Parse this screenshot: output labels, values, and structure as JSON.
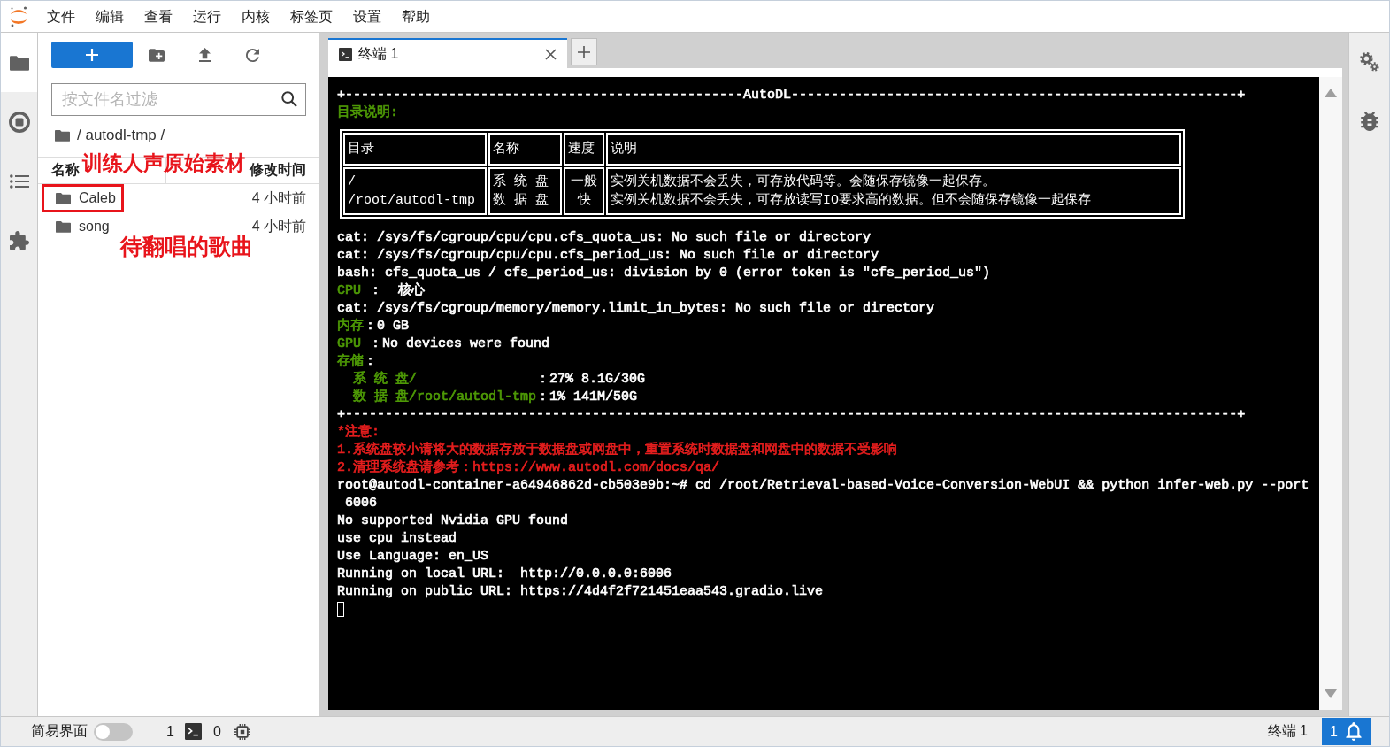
{
  "menu": [
    "文件",
    "编辑",
    "查看",
    "运行",
    "内核",
    "标签页",
    "设置",
    "帮助"
  ],
  "activity_bar": [
    {
      "kind": "files",
      "selected": true
    },
    {
      "kind": "running",
      "selected": false
    },
    {
      "kind": "toc",
      "selected": false
    },
    {
      "kind": "extensions",
      "selected": false
    }
  ],
  "file_browser": {
    "filter": {
      "placeholder": "按文件名过滤"
    },
    "breadcrumb": "/ autodl-tmp /",
    "columns": [
      "名称",
      "修改时间"
    ],
    "items": [
      {
        "name": "Caleb",
        "modified": "4 小时前",
        "boxed": true
      },
      {
        "name": "song",
        "modified": "4 小时前",
        "boxed": false
      }
    ],
    "annotations": [
      "训练人声原始素材",
      "待翻唱的歌曲"
    ]
  },
  "tabs": [
    {
      "label": "终端 1",
      "selected": true
    }
  ],
  "terminal": {
    "header_lines": [
      [
        {
          "text": "+--------------------------------------------------AutoDL--------------------------------------------------------+",
          "color": "#ffffff"
        }
      ],
      [
        {
          "text": "目录说明:",
          "color": "#4e9a06"
        }
      ]
    ],
    "table": {
      "columns": [
        "目录",
        "名称",
        "速度",
        "说明"
      ],
      "rows": [
        [
          [
            "/",
            "/root/autodl-tmp"
          ],
          [
            "系 统 盘",
            "数 据 盘"
          ],
          [
            "一般",
            "快"
          ],
          [
            "实例关机数据不会丢失，可存放代码等。会随保存镜像一起保存。",
            "实例关机数据不会丢失，可存放读写IO要求高的数据。但不会随保存镜像一起保存"
          ]
        ]
      ]
    },
    "lines": [
      [
        {
          "text": "cat: /sys/fs/cgroup/cpu/cpu.cfs_quota_us: No such file or directory",
          "color": "#ffffff"
        }
      ],
      [
        {
          "text": "cat: /sys/fs/cgroup/cpu/cpu.cfs_period_us: No such file or directory",
          "color": "#ffffff"
        }
      ],
      [
        {
          "text": "bash: cfs_quota_us / cfs_period_us: division by 0 (error token is \"cfs_period_us\")",
          "color": "#ffffff"
        }
      ],
      [
        {
          "text": "CPU",
          "color": "#4e9a06"
        },
        {
          "text": " ：  核心",
          "color": "#ffffff"
        }
      ],
      [
        {
          "text": "cat: /sys/fs/cgroup/memory/memory.limit_in_bytes: No such file or directory",
          "color": "#ffffff"
        }
      ],
      [
        {
          "text": "内存",
          "color": "#4e9a06"
        },
        {
          "text": "：0 GB",
          "color": "#ffffff"
        }
      ],
      [
        {
          "text": "GPU",
          "color": "#4e9a06"
        },
        {
          "text": " ：No devices were found",
          "color": "#ffffff"
        }
      ],
      [
        {
          "text": "存储",
          "color": "#4e9a06"
        },
        {
          "text": "：",
          "color": "#ffffff"
        }
      ],
      [
        {
          "text": "  系 统 盘/",
          "color": "#4e9a06"
        },
        {
          "text": "               ：27% 8.1G/30G",
          "color": "#ffffff"
        }
      ],
      [
        {
          "text": "  数 据 盘/root/autodl-tmp",
          "color": "#4e9a06"
        },
        {
          "text": "：1% 141M/50G",
          "color": "#ffffff"
        }
      ],
      [
        {
          "text": "+----------------------------------------------------------------------------------------------------------------+",
          "color": "#ffffff"
        }
      ],
      [
        {
          "text": "*注意:",
          "color": "#e61e1e"
        }
      ],
      [
        {
          "text": "1.系统盘较小请将大的数据存放于数据盘或网盘中，重置系统时数据盘和网盘中的数据不受影响",
          "color": "#e61e1e"
        }
      ],
      [
        {
          "text": "2.清理系统盘请参考：https://www.autodl.com/docs/qa/",
          "color": "#e61e1e"
        }
      ],
      [
        {
          "text": "root@autodl-container-a64946862d-cb503e9b:~# cd /root/Retrieval-based-Voice-Conversion-WebUI && python infer-web.py --port",
          "color": "#ffffff"
        }
      ],
      [
        {
          "text": " 6006",
          "color": "#ffffff"
        }
      ],
      [
        {
          "text": "No supported Nvidia GPU found",
          "color": "#ffffff"
        }
      ],
      [
        {
          "text": "use cpu instead",
          "color": "#ffffff"
        }
      ],
      [
        {
          "text": "Use Language: en_US",
          "color": "#ffffff"
        }
      ],
      [
        {
          "text": "Running on local URL:  http://0.0.0.0:6006",
          "color": "#ffffff"
        }
      ],
      [
        {
          "text": "Running on public URL: https://4d4f2f721451eaa543.gradio.live",
          "color": "#ffffff"
        }
      ]
    ]
  },
  "status_bar": {
    "simple_mode": {
      "label": "简易界面",
      "on": false
    },
    "terminals": "1",
    "kernels": "0",
    "current": "终端 1",
    "notifications": "1"
  }
}
